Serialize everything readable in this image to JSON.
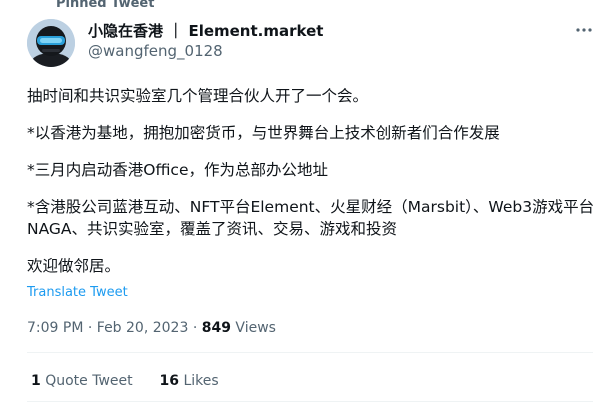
{
  "pinned_label": "Pinned Tweet",
  "author": {
    "name": "小隐在香港 ｜ Element.market",
    "handle": "@wangfeng_0128"
  },
  "more_icon": "more-horizontal-icon",
  "paragraphs": [
    "抽时间和共识实验室几个管理合伙人开了一个会。",
    "*以香港为基地，拥抱加密货币，与世界舞台上技术创新者们合作发展",
    "*三月内启动香港Office，作为总部办公地址",
    "*含港股公司蓝港互动、NFT平台Element、火星财经（Marsbit）、Web3游戏平台NAGA、共识实验室，覆盖了资讯、交易、游戏和投资",
    "欢迎做邻居。"
  ],
  "translate_label": "Translate Tweet",
  "meta": {
    "time": "7:09 PM",
    "date": "Feb 20, 2023",
    "views_count": "849",
    "views_label": "Views"
  },
  "stats": {
    "quote_count": "1",
    "quote_label": "Quote Tweet",
    "likes_count": "16",
    "likes_label": "Likes"
  },
  "colors": {
    "link": "#1d9bf0",
    "secondary_text": "#536471",
    "divider": "#eff3f4"
  }
}
